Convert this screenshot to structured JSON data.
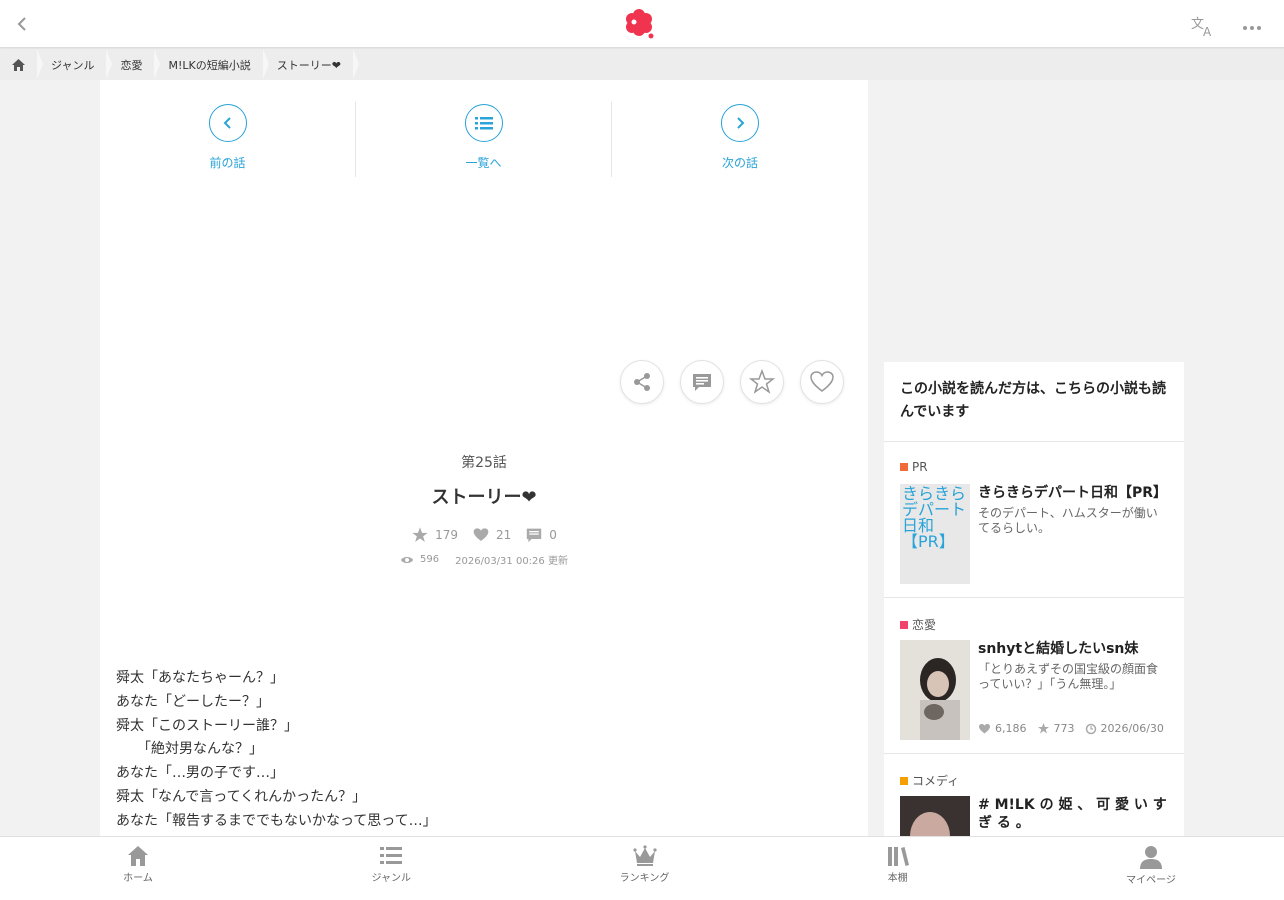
{
  "header": {
    "back_icon": "chevron-left-icon",
    "logo_icon": "flower-logo-icon",
    "translate_icon": "translate-icon",
    "more_icon": "more-horizontal-icon",
    "brand_color": "#f0344f"
  },
  "breadcrumb": {
    "home_icon": "home-icon",
    "items": [
      "ジャンル",
      "恋愛",
      "M!LKの短編小説",
      "ストーリー❤"
    ]
  },
  "episode_nav": {
    "prev": "前の話",
    "list": "一覧へ",
    "next": "次の話",
    "accent": "#29a3d8"
  },
  "actions": [
    "share-icon",
    "comment-icon",
    "star-icon",
    "heart-icon"
  ],
  "episode": {
    "number": "第25話",
    "title": "ストーリー❤",
    "stars": "179",
    "likes": "21",
    "comments": "0",
    "views": "596",
    "updated": "2026/03/31 00:26 更新"
  },
  "story_text": "舜太「あなたちゃーん？」\nあなた「どーしたー？」\n舜太「このストーリー誰？」\n　　「絶対男なんな？」\nあなた「…男の子です…」\n舜太「なんで言ってくれんかったん？」\nあなた「報告するまででもないかなって思って…」",
  "sidebar": {
    "heading": "この小説を読んだ方は、こちらの小説も読んでいます",
    "cards": [
      {
        "tag": "PR",
        "tag_color": "#f06a3a",
        "thumb_alt": "きらきらデパート日和【PR】",
        "title": "きらきらデパート日和【PR】",
        "desc": "そのデパート、ハムスターが働いてるらしい。"
      },
      {
        "tag": "恋愛",
        "tag_color": "#f0446a",
        "title": "snhytと結婚したいsn妹",
        "desc": "「とりあえずその国宝級の顔面食っていい？」「うん無理。」",
        "likes": "6,186",
        "stars": "773",
        "date": "2026/06/30"
      },
      {
        "tag": "コメディ",
        "tag_color": "#f5a000",
        "title": "# M!LK の 姫 、 可 愛 い す ぎ る 。"
      }
    ]
  },
  "bottom_nav": [
    "ホーム",
    "ジャンル",
    "ランキング",
    "本棚",
    "マイページ"
  ]
}
